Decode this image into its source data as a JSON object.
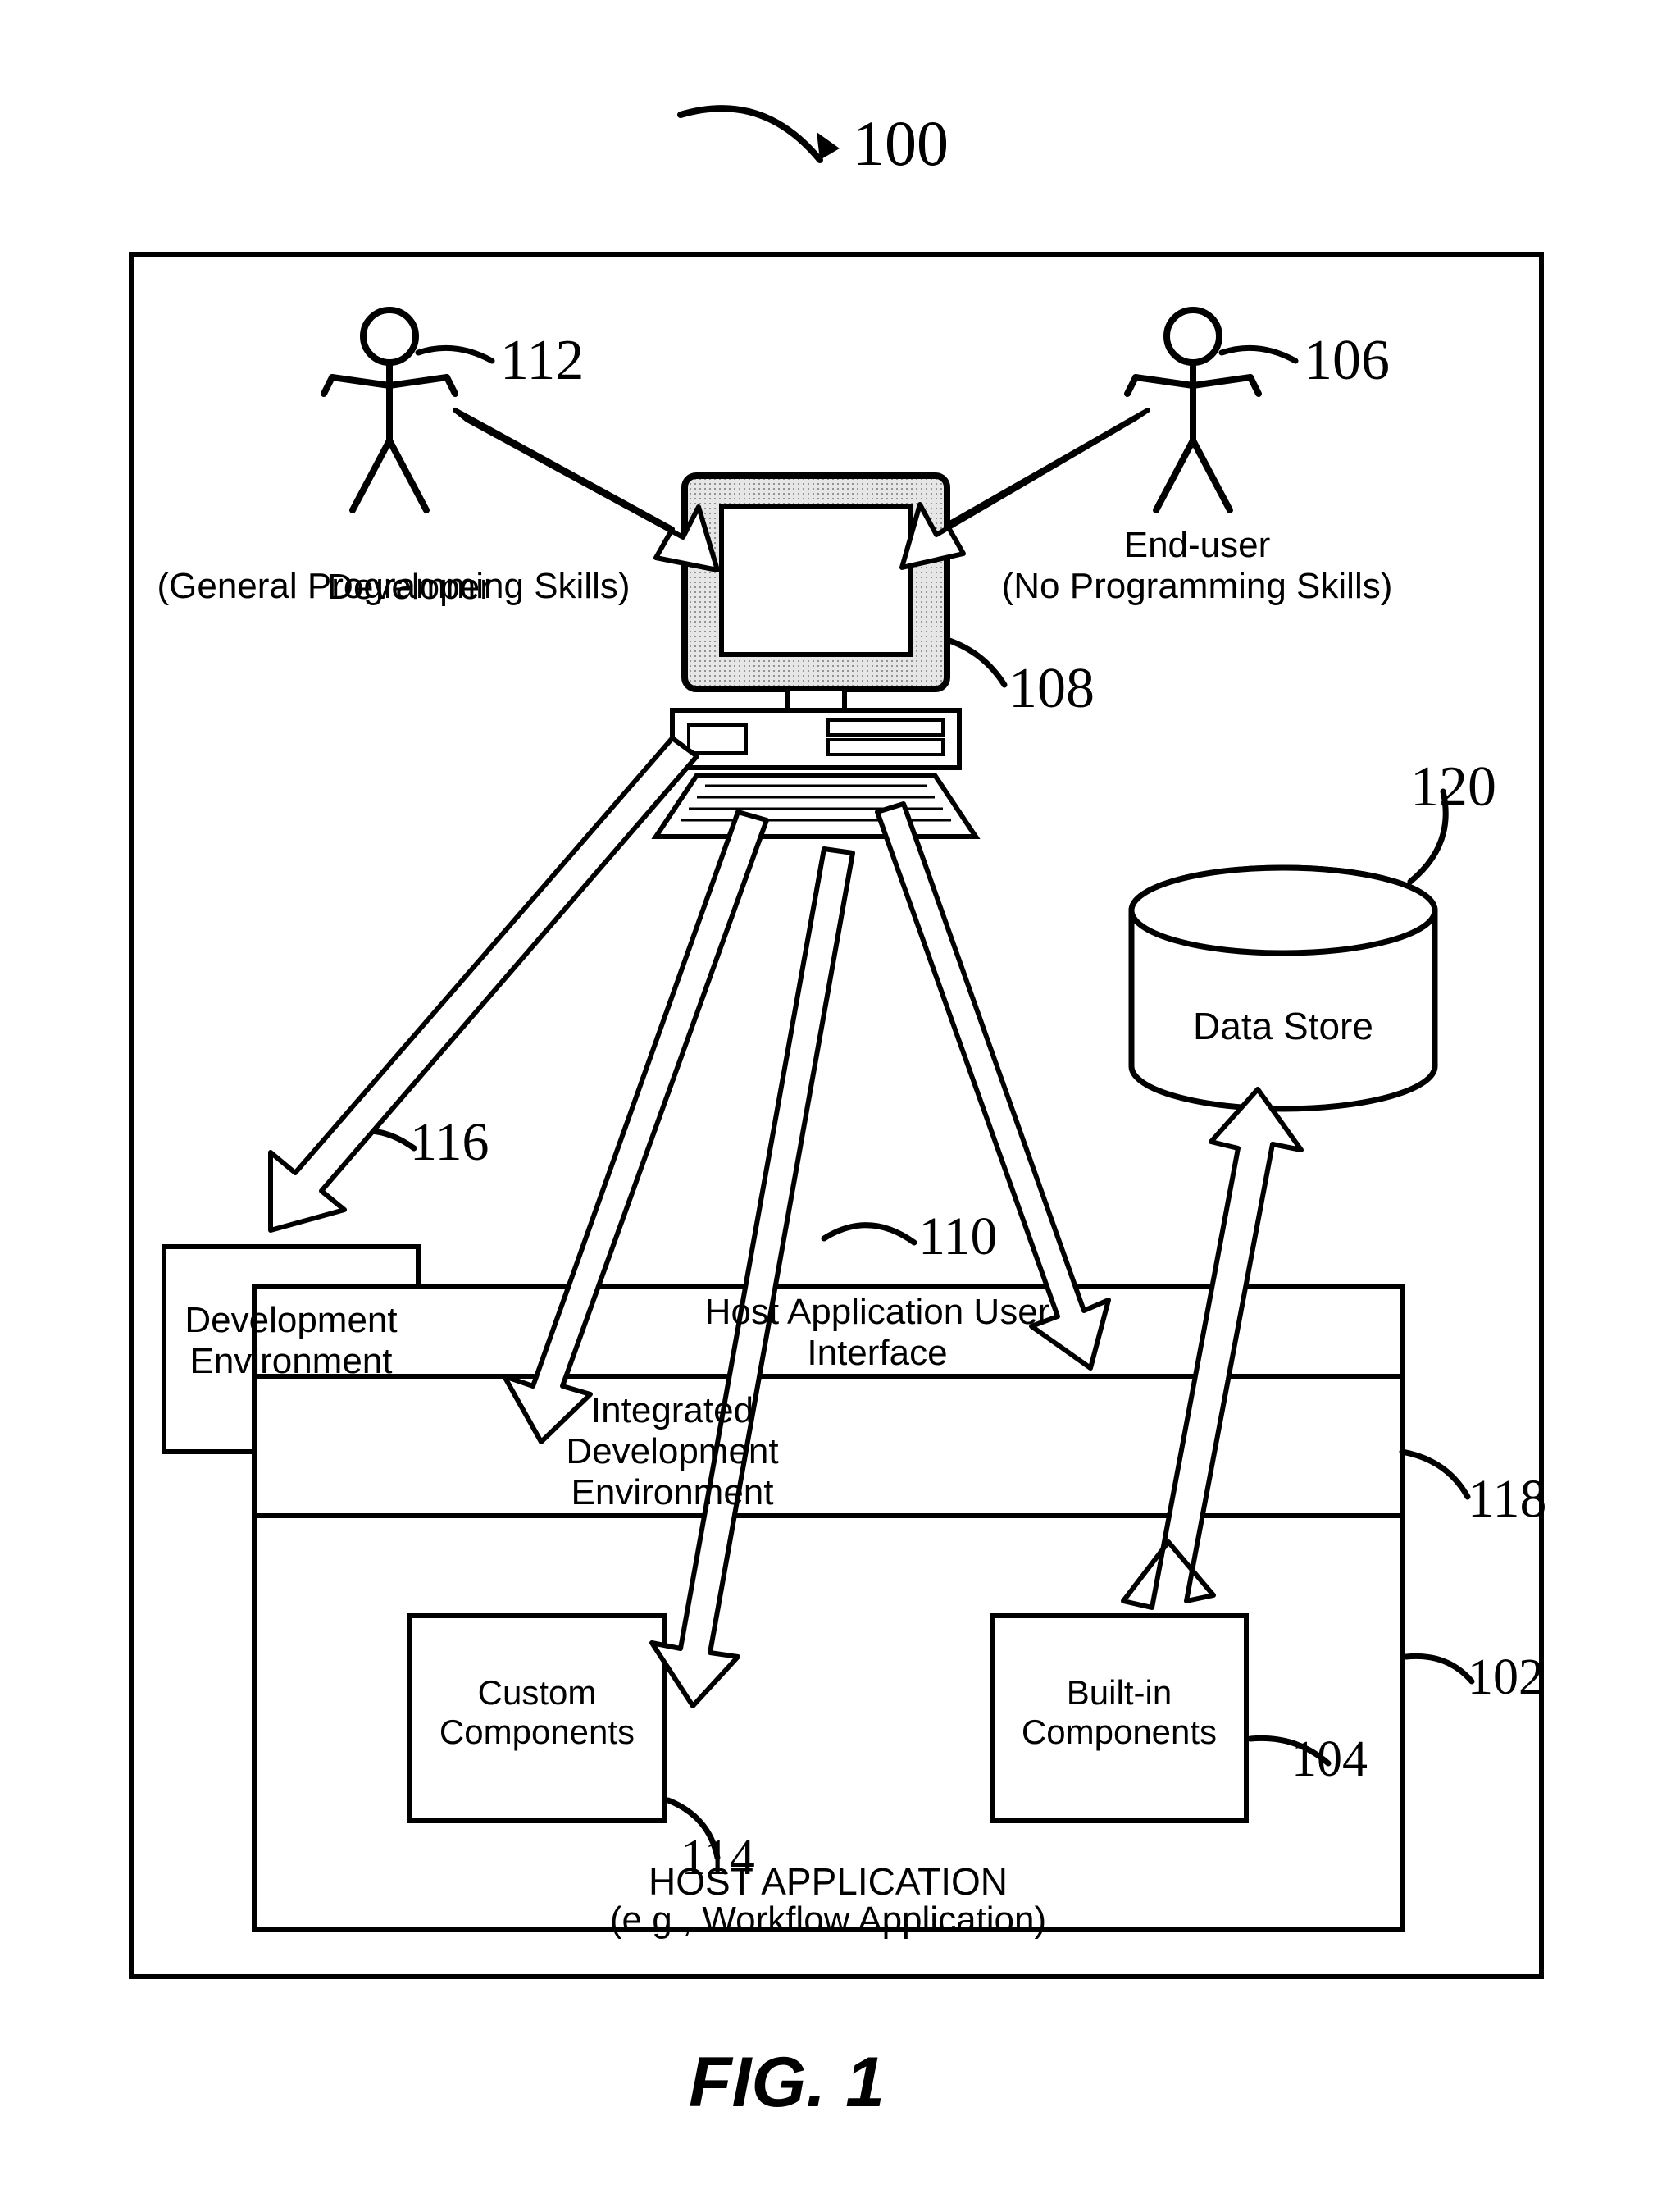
{
  "figure": {
    "caption": "FIG. 1"
  },
  "refs": {
    "system": "100",
    "developer": "112",
    "end_user": "106",
    "computer": "108",
    "data_store": "120",
    "dev_env": "116",
    "host_ui": "110",
    "ide": "118",
    "host_app": "102",
    "builtin": "104",
    "custom": "114"
  },
  "actors": {
    "developer": {
      "title": "Developer",
      "subtitle": "(General Programming Skills)"
    },
    "end_user": {
      "title": "End-user",
      "subtitle": "(No Programming Skills)"
    }
  },
  "nodes": {
    "data_store": "Data Store",
    "dev_env": "Development\nEnvironment",
    "host_ui": "Host Application\nUser Interface",
    "ide": "Integrated\nDevelopment\nEnvironment",
    "custom": "Custom\nComponents",
    "builtin": "Built-in\nComponents",
    "host_app_title": "HOST APPLICATION",
    "host_app_sub": "(e.g., Workflow Application)"
  }
}
